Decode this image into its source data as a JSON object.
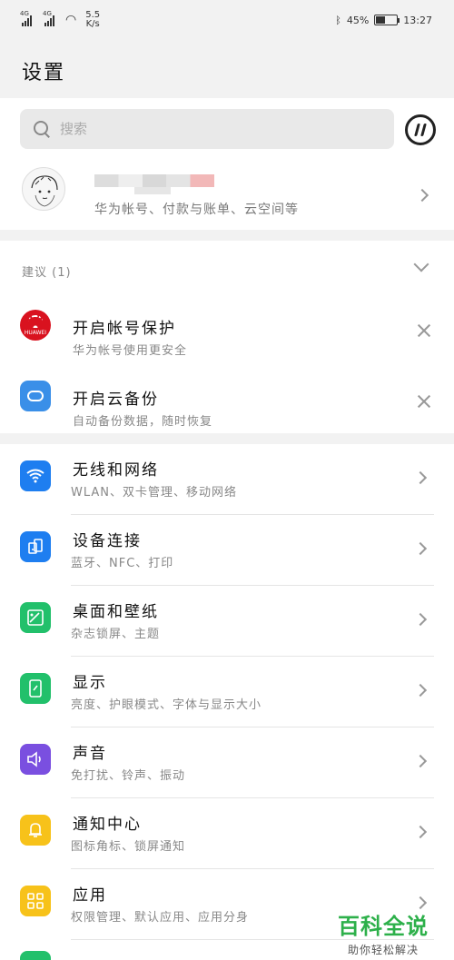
{
  "status_bar": {
    "network1": "4G",
    "network2": "4G",
    "speed_value": "5.5",
    "speed_unit": "K/s",
    "battery_percent": "45%",
    "battery_level": 0.45,
    "time": "13:27"
  },
  "header": {
    "title": "设置"
  },
  "search": {
    "placeholder": "搜索"
  },
  "account": {
    "subtitle": "华为帐号、付款与账单、云空间等"
  },
  "suggestions": {
    "header": "建议 (1)",
    "items": [
      {
        "title": "开启帐号保护",
        "subtitle": "华为帐号使用更安全",
        "icon": "huawei-logo",
        "logo_text": "HUAWEI"
      },
      {
        "title": "开启云备份",
        "subtitle": "自动备份数据，随时恢复",
        "icon": "cloud-backup-icon"
      }
    ]
  },
  "settings": [
    {
      "title": "无线和网络",
      "subtitle": "WLAN、双卡管理、移动网络",
      "icon": "wifi-icon",
      "color": "#1e7ef0"
    },
    {
      "title": "设备连接",
      "subtitle": "蓝牙、NFC、打印",
      "icon": "device-connection-icon",
      "color": "#1e7ef0"
    },
    {
      "title": "桌面和壁纸",
      "subtitle": "杂志锁屏、主题",
      "icon": "wallpaper-icon",
      "color": "#22c06b"
    },
    {
      "title": "显示",
      "subtitle": "亮度、护眼模式、字体与显示大小",
      "icon": "display-icon",
      "color": "#22c06b"
    },
    {
      "title": "声音",
      "subtitle": "免打扰、铃声、振动",
      "icon": "sound-icon",
      "color": "#7a4fe0"
    },
    {
      "title": "通知中心",
      "subtitle": "图标角标、锁屏通知",
      "icon": "notification-icon",
      "color": "#f7c21a"
    },
    {
      "title": "应用",
      "subtitle": "权限管理、默认应用、应用分身",
      "icon": "apps-icon",
      "color": "#f7c21a"
    }
  ],
  "watermark": {
    "title": "百科全说",
    "subtitle": "助你轻松解决"
  }
}
